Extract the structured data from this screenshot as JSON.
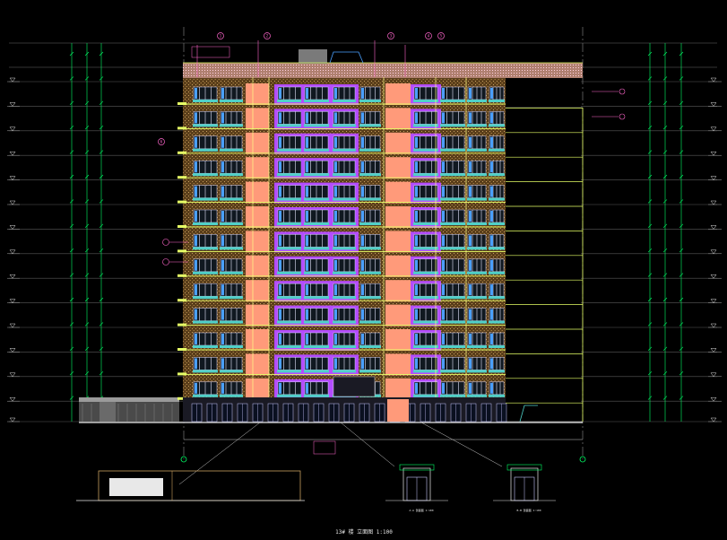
{
  "drawing": {
    "title": "13# 楼 立面图 1:100",
    "detail_left_label": "A-A 剖面图 1:100",
    "detail_right_label": "B-B 剖面图 1:100",
    "tag_labels": [
      "1",
      "2",
      "3",
      "4",
      "5",
      "6"
    ]
  },
  "colors": {
    "background": "#000000",
    "axis_line": "#00ff66",
    "wall_texture": "#7a5a2a",
    "window_accent": "#b44cff",
    "panel_orange": "#ff9a7a",
    "glazing": "#4aa0ff",
    "slab": "#e6ff66",
    "roof": "#ffd0e0",
    "dim_line": "#ff66cc"
  },
  "icons": [
    "floor-level-marker-icon",
    "section-tag-icon",
    "grid-axis-bubble-icon"
  ]
}
